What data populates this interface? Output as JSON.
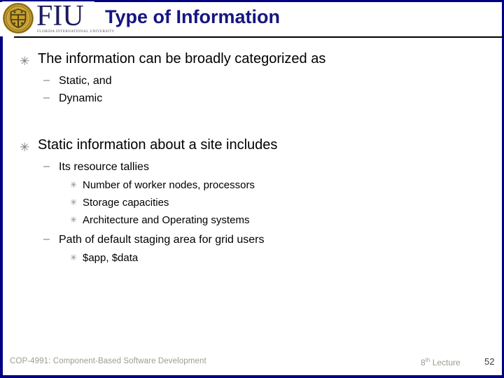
{
  "slide": {
    "title": "Type of Information",
    "logo": {
      "seal_icon": "fiu-seal-icon",
      "wordmark": "FIU",
      "university_name": "FLORIDA INTERNATIONAL UNIVERSITY"
    },
    "colors": {
      "frame": "#000080",
      "title": "#151580",
      "body_text": "#000000",
      "bullet_gray": "#7a7a7a",
      "footer_gray": "#9c9c90",
      "page_number": "#3a3a3a",
      "seal_gold": "#c9a227"
    },
    "bullets": {
      "level1_glyph": "✳",
      "level2_glyph": "–",
      "level3_glyph": "✳"
    },
    "content": [
      {
        "level": 1,
        "text": "The information can be broadly categorized as"
      },
      {
        "level": 2,
        "text": "Static, and"
      },
      {
        "level": 2,
        "text": "Dynamic"
      },
      {
        "level": 1,
        "text": "Static information about a site includes"
      },
      {
        "level": 2,
        "text": "Its resource tallies"
      },
      {
        "level": 3,
        "text": "Number of worker nodes, processors"
      },
      {
        "level": 3,
        "text": "Storage capacities"
      },
      {
        "level": 3,
        "text": "Architecture and Operating systems"
      },
      {
        "level": 2,
        "text": "Path of default staging area for grid users"
      },
      {
        "level": 3,
        "text": "$app, $data"
      }
    ],
    "footer": {
      "course": "COP-4991: Component-Based Software Development",
      "lecture_number": "8",
      "lecture_ordinal": "th",
      "lecture_label": "Lecture",
      "page_number": "52"
    }
  }
}
